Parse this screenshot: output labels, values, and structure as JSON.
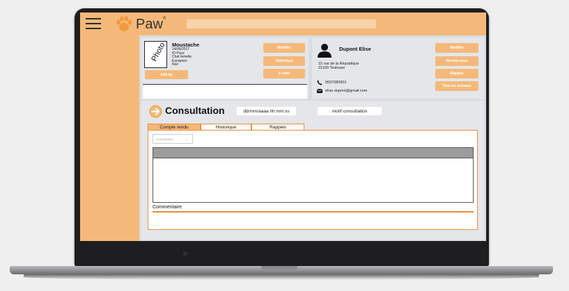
{
  "app": {
    "logo_text": "Paw",
    "logo_mark": "®",
    "search_placeholder": ""
  },
  "icons": {
    "menu": "hamburger-icon",
    "logo": "paw-icon",
    "owner": "person-icon",
    "phone": "phone-icon",
    "mail": "mail-icon",
    "consultation": "arrow-right-circle-icon",
    "select": "chevron-down-icon"
  },
  "colors": {
    "brand_orange": "#f4b97a",
    "accent_orange": "#f08a3c",
    "paw_orange": "#f39a3a"
  },
  "animal": {
    "photo_label": "Photo",
    "name": "Moustache",
    "birthdate": "14/06/2017",
    "chip": "ID Puce",
    "species": "Chat femelle",
    "breed": "Européen",
    "color": "Noir",
    "weight": "4,05 kg",
    "buttons": {
      "edit": "Modifier",
      "history": "Historique",
      "upcoming": "A venir"
    }
  },
  "owner": {
    "name": "Dupont Elise",
    "address1": "15 rue de la République",
    "address2": "31100 Toulouse",
    "phone": "0607080901",
    "email": "elise.dupont@gmail.com",
    "buttons": {
      "edit": "Modifier",
      "appointment": "Rendez-vous",
      "reminders": "Rappels",
      "all_animals": "Tous les animaux"
    }
  },
  "consultation": {
    "title": "Consultation",
    "date_value": "dd/mm/aaaa hh:mm:ss",
    "motif_value": "motif consultation",
    "tabs": [
      "Compte rendu",
      "Historique",
      "Rappels"
    ],
    "active_tab": "Compte rendu",
    "select_value": "Consultation",
    "comment_label": "Commentaire"
  }
}
